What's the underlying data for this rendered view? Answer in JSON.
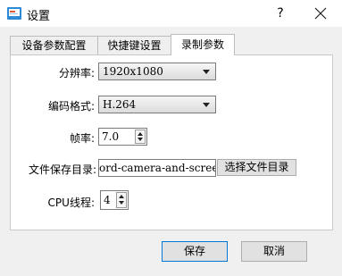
{
  "window": {
    "title": "设置",
    "help_label": "?"
  },
  "tabs": [
    {
      "label": "设备参数配置"
    },
    {
      "label": "快捷键设置"
    },
    {
      "label": "录制参数",
      "active": true
    }
  ],
  "form": {
    "resolution": {
      "label": "分辨率:",
      "value": "1920x1080"
    },
    "codec": {
      "label": "编码格式:",
      "value": "H.264"
    },
    "framerate": {
      "label": "帧率:",
      "value": "7.0"
    },
    "save_dir": {
      "label": "文件保存目录:",
      "value": "ord-camera-and-screen",
      "browse_label": "选择文件目录"
    },
    "cpu_threads": {
      "label": "CPU线程:",
      "value": "4"
    }
  },
  "footer": {
    "save_label": "保存",
    "cancel_label": "取消"
  },
  "colors": {
    "accent": "#0078d7"
  }
}
